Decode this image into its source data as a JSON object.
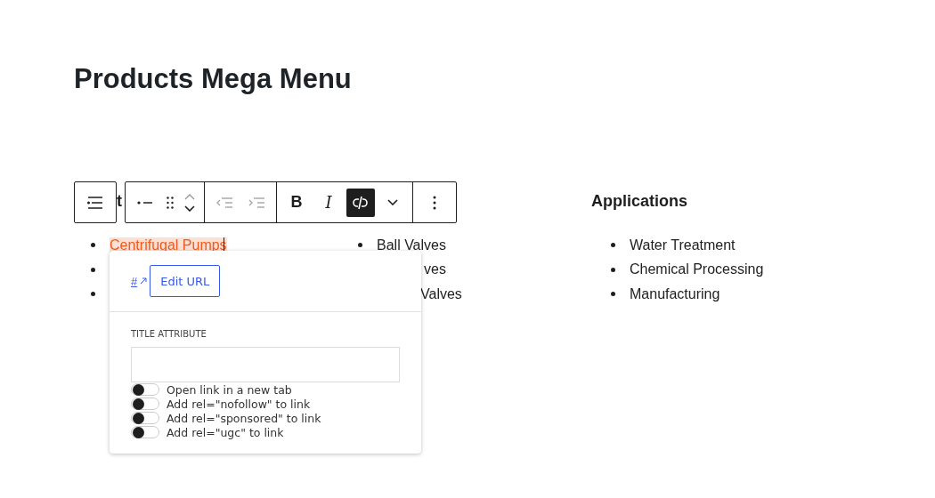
{
  "title": "Products Mega Menu",
  "columns": [
    {
      "heading": "t",
      "items": [
        {
          "text": "Centrifugal Pumps",
          "selected": true,
          "bullet": true
        },
        {
          "bullet": true
        },
        {
          "bullet": true
        }
      ]
    },
    {
      "items": [
        {
          "text": "Ball Valves",
          "selected": false,
          "bullet": true
        },
        {
          "text": "ves",
          "selected": false,
          "bullet": false
        },
        {
          "text": "Valves",
          "selected": false,
          "bullet": false
        }
      ]
    },
    {
      "heading": "Applications",
      "items": [
        {
          "text": "Water Treatment",
          "selected": false,
          "bullet": true
        },
        {
          "text": "Chemical Processing",
          "selected": false,
          "bullet": true
        },
        {
          "text": "Manufacturing",
          "selected": false,
          "bullet": true
        }
      ]
    }
  ],
  "toolbar": {
    "bold": "B",
    "italic": "I",
    "link_active": true
  },
  "popover": {
    "link": "#",
    "edit_button": "Edit URL",
    "title_label": "TITLE ATTRIBUTE",
    "toggles": [
      {
        "label": "Open link in a new tab",
        "on": false
      },
      {
        "label": "Add rel=\"nofollow\" to link",
        "on": false
      },
      {
        "label": "Add rel=\"sponsored\" to link",
        "on": false
      },
      {
        "label": "Add rel=\"ugc\" to link",
        "on": false
      }
    ]
  }
}
